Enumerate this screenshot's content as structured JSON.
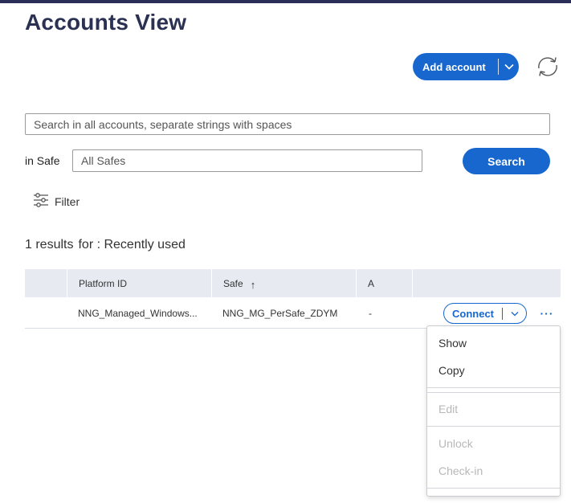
{
  "page": {
    "title": "Accounts View"
  },
  "toolbar": {
    "add_account_label": "Add account"
  },
  "search": {
    "all_placeholder": "Search in all accounts, separate strings with spaces",
    "in_safe_label": "in Safe",
    "safe_placeholder": "All Safes",
    "button_label": "Search"
  },
  "filter": {
    "label": "Filter"
  },
  "results": {
    "count_text": "1 results",
    "for_text": "for : Recently used"
  },
  "table": {
    "columns": [
      "Platform ID",
      "Safe",
      "A"
    ],
    "sort_indicator": "↑",
    "rows": [
      {
        "platform_id": "NNG_Managed_Windows...",
        "safe": "NNG_MG_PerSafe_ZDYM",
        "a": "-"
      }
    ],
    "connect_label": "Connect",
    "more_label": "···"
  },
  "menu": {
    "show": "Show",
    "copy": "Copy",
    "edit": "Edit",
    "unlock": "Unlock",
    "checkin": "Check-in"
  },
  "colors": {
    "accent": "#1767cf",
    "title": "#2b3153",
    "header_bg": "#e7ebf1",
    "disabled": "#b8b8b8"
  }
}
